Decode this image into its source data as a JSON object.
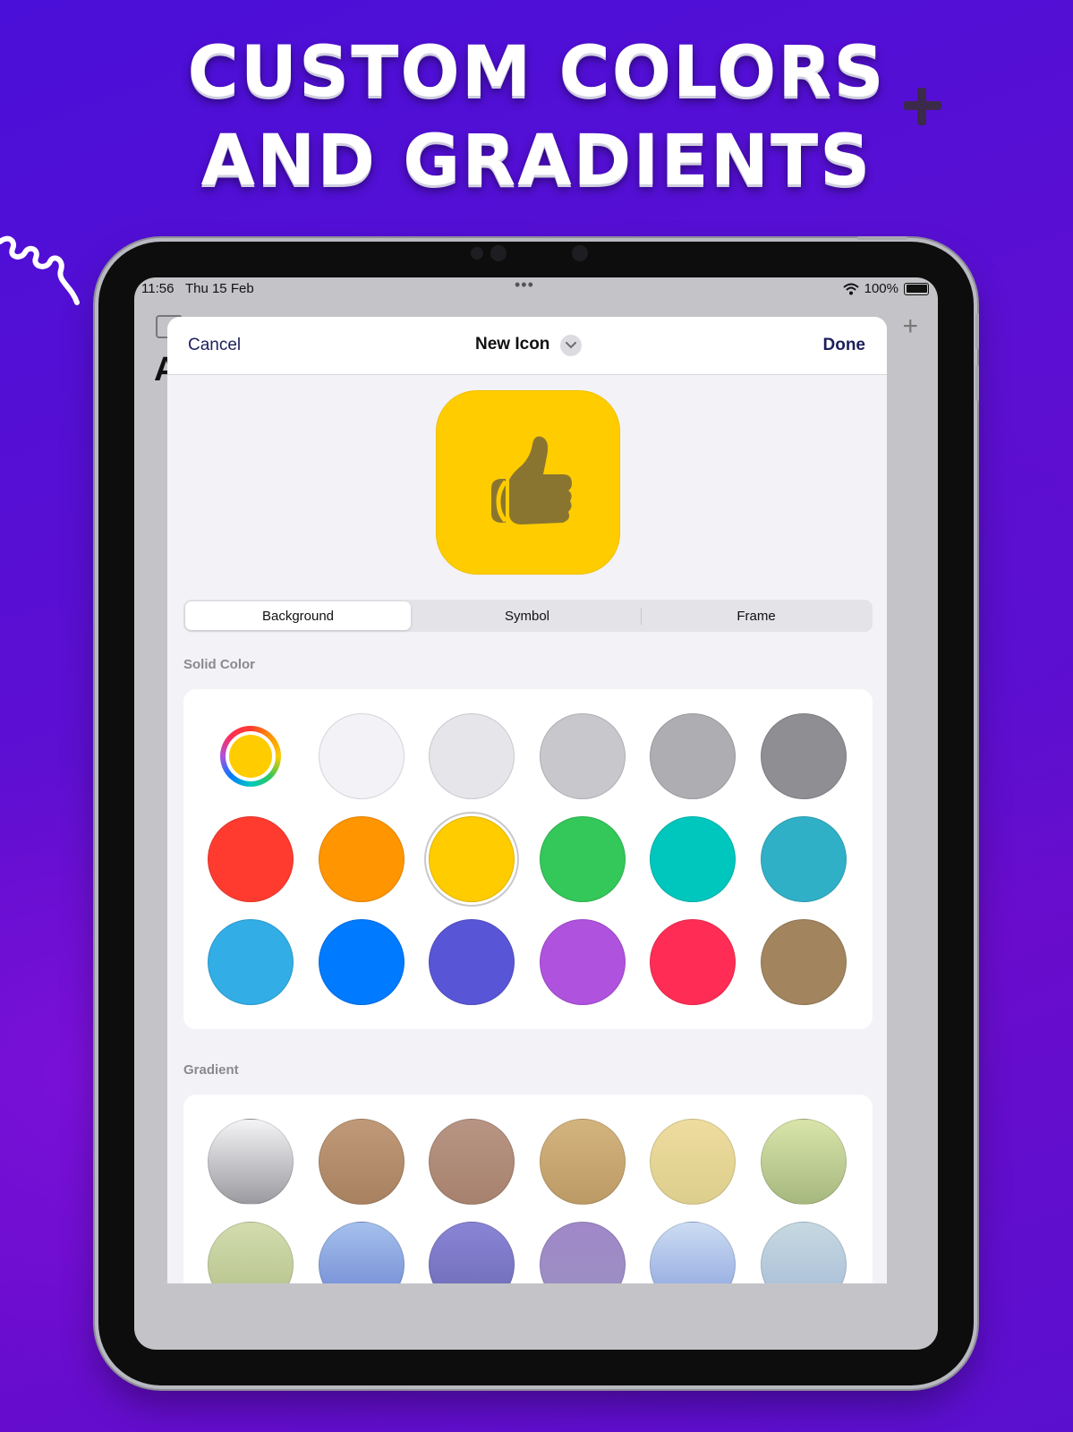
{
  "headline": {
    "line1": "CUSTOM COLORS",
    "line2": "AND GRADIENTS"
  },
  "status_bar": {
    "time": "11:56",
    "date": "Thu 15 Feb",
    "battery": "100%"
  },
  "background_app": {
    "title_initial": "A"
  },
  "sheet": {
    "cancel_label": "Cancel",
    "title": "New Icon",
    "done_label": "Done",
    "preview": {
      "background": "#ffcc00",
      "symbol_color": "#8a7530",
      "symbol": "thumbs-up-icon"
    },
    "tabs": [
      {
        "label": "Background",
        "selected": true
      },
      {
        "label": "Symbol",
        "selected": false
      },
      {
        "label": "Frame",
        "selected": false
      }
    ],
    "solid_color": {
      "label": "Solid Color",
      "picker_color": "#ffcc00",
      "colors": [
        "#f2f2f7",
        "#e5e5ea",
        "#c7c7cc",
        "#aeaeb2",
        "#8e8e93",
        "#ff3b30",
        "#ff9500",
        "#ffcc00",
        "#34c759",
        "#00c7be",
        "#30b0c7",
        "#32ade6",
        "#007aff",
        "#5856d6",
        "#af52de",
        "#ff2d55",
        "#a2845e"
      ],
      "selected_color": "#ffcc00"
    },
    "gradient": {
      "label": "Gradient",
      "gradients": [
        [
          "#f4f4f6",
          "#9a9aa0"
        ],
        [
          "#c09a78",
          "#a88260"
        ],
        [
          "#b89484",
          "#a6826e"
        ],
        [
          "#d4b47e",
          "#bc9a66"
        ],
        [
          "#eedc9e",
          "#dcce8c"
        ],
        [
          "#d8e4aa",
          "#a6b87e"
        ],
        [
          "#d2dcae",
          "#b4c08a"
        ],
        [
          "#a4c0ec",
          "#6e86d2"
        ],
        [
          "#8a84d6",
          "#6c6cb4"
        ],
        [
          "#a088c8",
          "#9a90c2"
        ],
        [
          "#ccdcf2",
          "#8aa2de"
        ],
        [
          "#c6d8e0",
          "#a6bcd8"
        ]
      ]
    }
  },
  "colors": {
    "accent": "#1c1f5c"
  }
}
